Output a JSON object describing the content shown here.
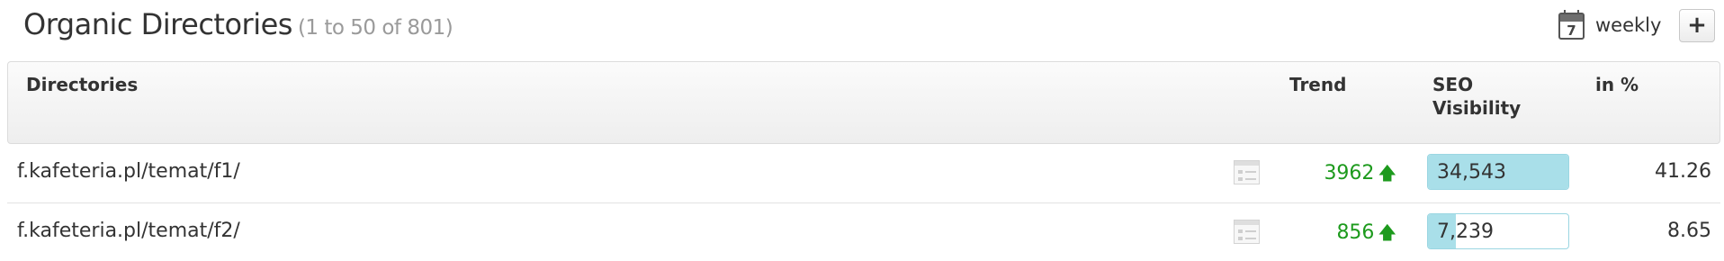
{
  "header": {
    "title": "Organic Directories",
    "range": "(1 to 50 of 801)",
    "calendar_icon_number": "7",
    "interval_label": "weekly",
    "add_label": "+"
  },
  "table": {
    "columns": [
      "Directories",
      "Trend",
      "SEO Visibility",
      "in %"
    ],
    "rows": [
      {
        "directory": "f.kafeteria.pl/temat/f1/",
        "trend": "3962",
        "trend_direction": "up",
        "seo_visibility": "34,543",
        "visibility_fraction": 1.0,
        "percent": "41.26"
      },
      {
        "directory": "f.kafeteria.pl/temat/f2/",
        "trend": "856",
        "trend_direction": "up",
        "seo_visibility": "7,239",
        "visibility_fraction": 0.2,
        "percent": "8.65"
      }
    ]
  },
  "colors": {
    "trend_up": "#1d9a1d",
    "visibility_bar": "#a9dfe9"
  }
}
